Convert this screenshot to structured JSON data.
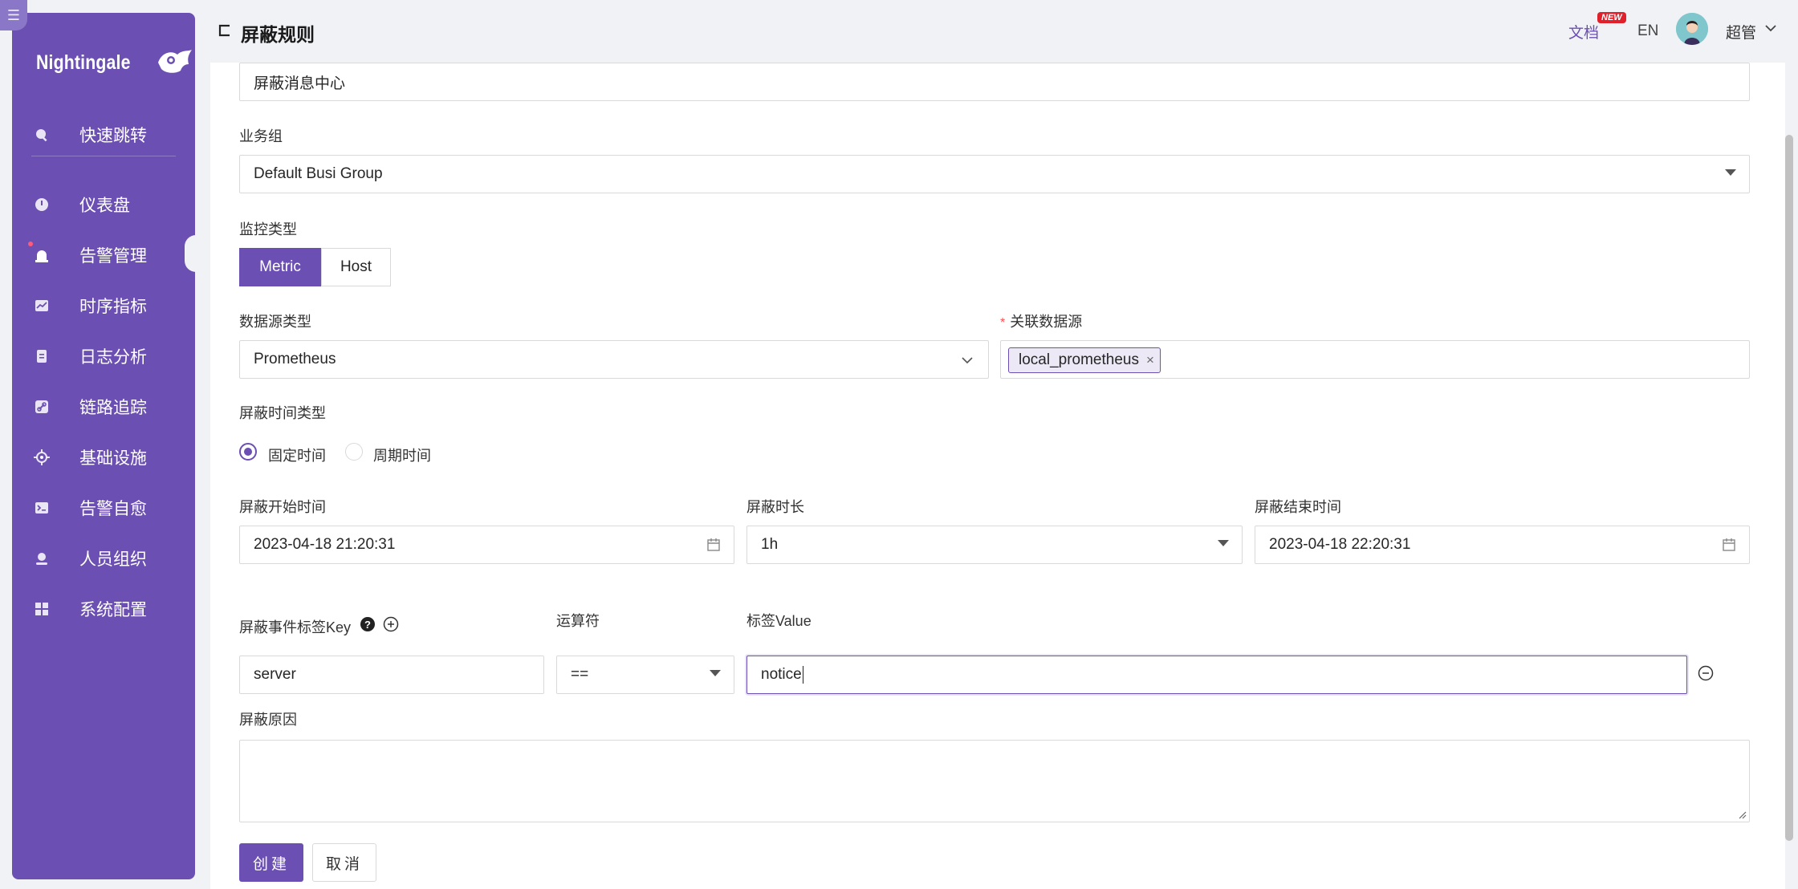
{
  "sidebar": {
    "logo_text": "Nightingale",
    "items": [
      {
        "label": "快速跳转",
        "icon": "search-icon"
      },
      {
        "label": "仪表盘",
        "icon": "dashboard-icon"
      },
      {
        "label": "告警管理",
        "icon": "alarm-icon"
      },
      {
        "label": "时序指标",
        "icon": "chart-icon"
      },
      {
        "label": "日志分析",
        "icon": "log-icon"
      },
      {
        "label": "链路追踪",
        "icon": "link-icon"
      },
      {
        "label": "基础设施",
        "icon": "crosshair-icon"
      },
      {
        "label": "告警自愈",
        "icon": "terminal-icon"
      },
      {
        "label": "人员组织",
        "icon": "user-icon"
      },
      {
        "label": "系统配置",
        "icon": "grid-icon"
      }
    ]
  },
  "header": {
    "title": "屏蔽规则",
    "doc_link": "文档",
    "new_badge": "NEW",
    "lang": "EN",
    "user_name": "超管"
  },
  "form": {
    "note_value": "屏蔽消息中心",
    "busi_group_label": "业务组",
    "busi_group_value": "Default Busi Group",
    "monitor_type_label": "监控类型",
    "monitor_types": [
      "Metric",
      "Host"
    ],
    "monitor_type_selected": "Metric",
    "datasource_type_label": "数据源类型",
    "datasource_type_value": "Prometheus",
    "datasource_label": "关联数据源",
    "datasource_tag": "local_prometheus",
    "time_type_label": "屏蔽时间类型",
    "time_type_options": [
      "固定时间",
      "周期时间"
    ],
    "time_type_selected": "固定时间",
    "start_label": "屏蔽开始时间",
    "start_value": "2023-04-18 21:20:31",
    "duration_label": "屏蔽时长",
    "duration_value": "1h",
    "end_label": "屏蔽结束时间",
    "end_value": "2023-04-18 22:20:31",
    "tag_key_label": "屏蔽事件标签Key",
    "operator_label": "运算符",
    "tag_value_label": "标签Value",
    "tag_key_value": "server",
    "operator_value": "==",
    "tag_value_value": "notice",
    "reason_label": "屏蔽原因",
    "reason_value": ""
  },
  "buttons": {
    "create": "创建",
    "cancel": "取消"
  },
  "colors": {
    "brand": "#6b4fb3",
    "required": "#ff4d4f",
    "badge": "#e0202a"
  }
}
